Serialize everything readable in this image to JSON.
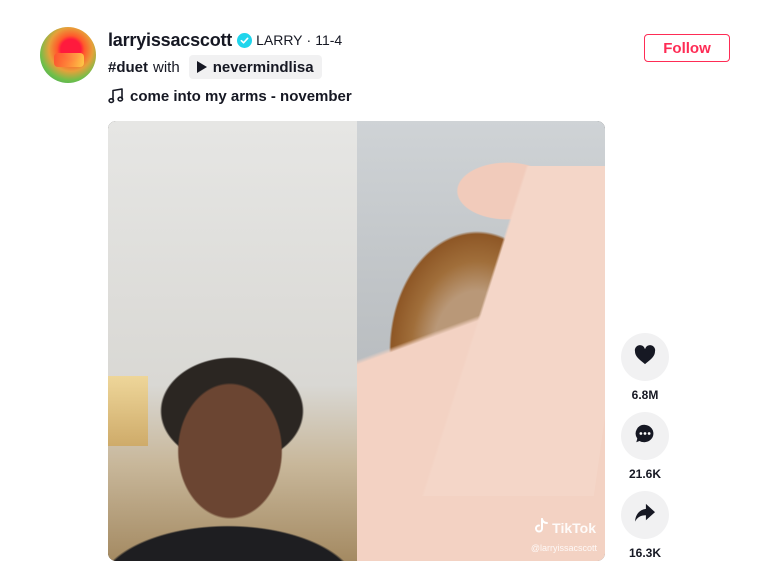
{
  "author": {
    "username": "larryissacscott",
    "nickname": "LARRY",
    "separator": "·",
    "date": "11-4",
    "verified": true
  },
  "follow_label": "Follow",
  "description": {
    "hashtag": "#duet",
    "with_text": "with",
    "duet_user": "nevermindlisa"
  },
  "music": {
    "title": "come into my arms - november"
  },
  "video": {
    "watermark": "TikTok",
    "watermark_handle": "@larryissacscott"
  },
  "actions": {
    "likes": "6.8M",
    "comments": "21.6K",
    "shares": "16.3K"
  },
  "colors": {
    "accent": "#fe2c55",
    "verified": "#20d5ec",
    "action_bg": "#f1f1f2",
    "text": "#161823"
  },
  "icons": {
    "verified": "verified-badge-icon",
    "play": "play-icon",
    "music": "music-note-icon",
    "like": "heart-icon",
    "comment": "comment-icon",
    "share": "share-icon",
    "tiktok": "tiktok-logo-icon"
  }
}
